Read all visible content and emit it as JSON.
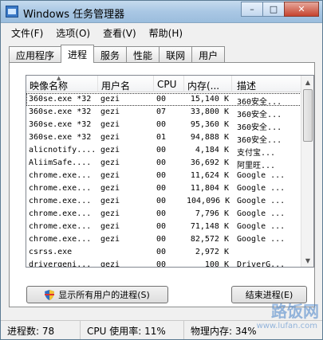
{
  "window": {
    "title": "Windows 任务管理器"
  },
  "title_buttons": {
    "minimize": "–",
    "maximize": "□",
    "close": "✕"
  },
  "menu": [
    "文件(F)",
    "选项(O)",
    "查看(V)",
    "帮助(H)"
  ],
  "tabs": [
    "应用程序",
    "进程",
    "服务",
    "性能",
    "联网",
    "用户"
  ],
  "active_tab": "进程",
  "columns": [
    "映像名称",
    "用户名",
    "CPU",
    "内存(...",
    "描述"
  ],
  "rows": [
    {
      "name": "360se.exe *32",
      "user": "gezi",
      "cpu": "00",
      "mem": "15,140 K",
      "desc": "360安全..."
    },
    {
      "name": "360se.exe *32",
      "user": "gezi",
      "cpu": "07",
      "mem": "33,800 K",
      "desc": "360安全..."
    },
    {
      "name": "360se.exe *32",
      "user": "gezi",
      "cpu": "00",
      "mem": "95,360 K",
      "desc": "360安全..."
    },
    {
      "name": "360se.exe *32",
      "user": "gezi",
      "cpu": "01",
      "mem": "94,888 K",
      "desc": "360安全..."
    },
    {
      "name": "alicnotify....",
      "user": "gezi",
      "cpu": "00",
      "mem": "4,184 K",
      "desc": "支付宝..."
    },
    {
      "name": "AliimSafe....",
      "user": "gezi",
      "cpu": "00",
      "mem": "36,692 K",
      "desc": "阿里旺..."
    },
    {
      "name": "chrome.exe...",
      "user": "gezi",
      "cpu": "00",
      "mem": "11,624 K",
      "desc": "Google ..."
    },
    {
      "name": "chrome.exe...",
      "user": "gezi",
      "cpu": "00",
      "mem": "11,804 K",
      "desc": "Google ..."
    },
    {
      "name": "chrome.exe...",
      "user": "gezi",
      "cpu": "00",
      "mem": "104,096 K",
      "desc": "Google ..."
    },
    {
      "name": "chrome.exe...",
      "user": "gezi",
      "cpu": "00",
      "mem": "7,796 K",
      "desc": "Google ..."
    },
    {
      "name": "chrome.exe...",
      "user": "gezi",
      "cpu": "00",
      "mem": "71,148 K",
      "desc": "Google ..."
    },
    {
      "name": "chrome.exe...",
      "user": "gezi",
      "cpu": "00",
      "mem": "82,572 K",
      "desc": "Google ..."
    },
    {
      "name": "csrss.exe",
      "user": "",
      "cpu": "00",
      "mem": "2,972 K",
      "desc": ""
    },
    {
      "name": "drivergeni...",
      "user": "gezi",
      "cpu": "00",
      "mem": "100 K",
      "desc": "DriverG..."
    }
  ],
  "buttons": {
    "show_all": "显示所有用户的进程(S)",
    "end_process": "结束进程(E)"
  },
  "status": {
    "processes": "进程数: 78",
    "cpu": "CPU 使用率: 11%",
    "memory": "物理内存: 34%"
  },
  "watermark": {
    "main": "路饭网",
    "sub": "www.lufan.com"
  },
  "colors": {
    "title_gradient_top": "#c5dbee",
    "close_button": "#c6432e",
    "selected_outline": "#333333"
  }
}
